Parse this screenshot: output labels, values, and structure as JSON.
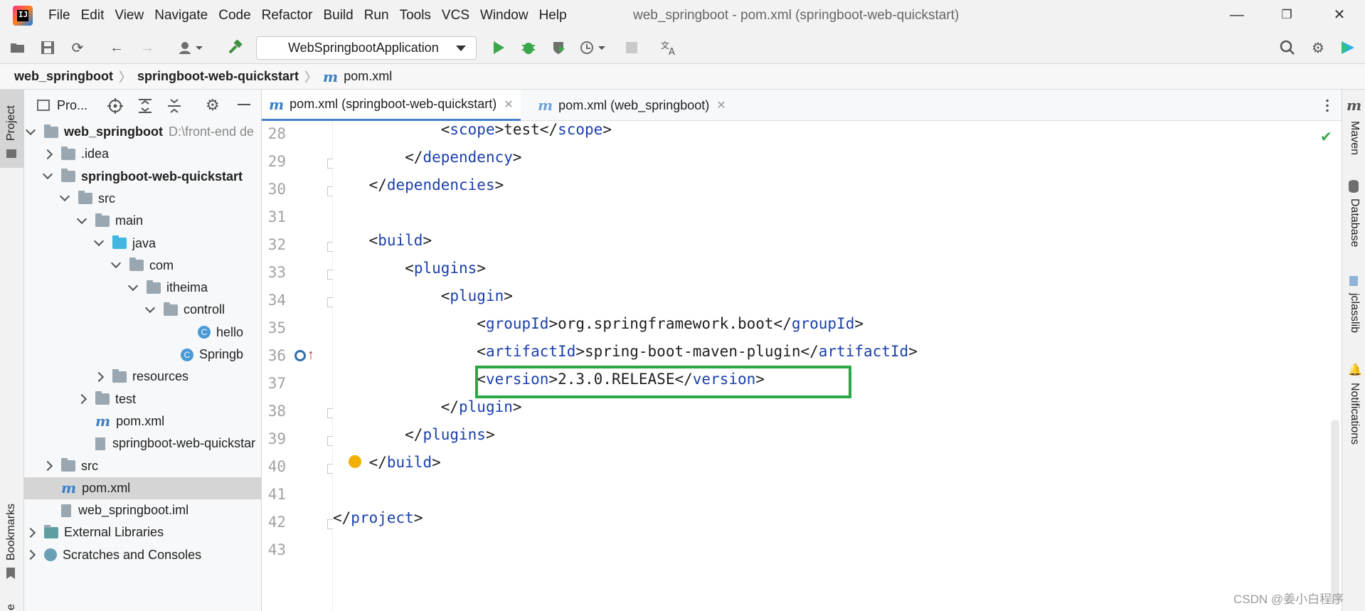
{
  "app": {
    "window_title": "web_springboot - pom.xml (springboot-web-quickstart)",
    "logo_text": "IJ"
  },
  "menu": [
    "File",
    "Edit",
    "View",
    "Navigate",
    "Code",
    "Refactor",
    "Build",
    "Run",
    "Tools",
    "VCS",
    "Window",
    "Help"
  ],
  "toolbar": {
    "run_configuration": "WebSpringbootApplication"
  },
  "breadcrumb": [
    "web_springboot",
    "springboot-web-quickstart",
    "pom.xml"
  ],
  "left_stripe": {
    "project": "Project",
    "bookmarks": "Bookmarks",
    "structure_fragment": "e"
  },
  "project_panel": {
    "title": "Pro...",
    "tree": [
      {
        "label": "web_springboot",
        "extra": "D:\\front-end de",
        "indent": 0,
        "arrow": "down",
        "icon": "module-folder",
        "bold": true
      },
      {
        "label": ".idea",
        "indent": 1,
        "arrow": "right",
        "icon": "folder"
      },
      {
        "label": "springboot-web-quickstart",
        "indent": 1,
        "arrow": "down",
        "icon": "module-folder",
        "bold": true
      },
      {
        "label": "src",
        "indent": 2,
        "arrow": "down",
        "icon": "folder"
      },
      {
        "label": "main",
        "indent": 3,
        "arrow": "down",
        "icon": "folder"
      },
      {
        "label": "java",
        "indent": 4,
        "arrow": "down",
        "icon": "folder-blue"
      },
      {
        "label": "com",
        "indent": 5,
        "arrow": "down",
        "icon": "folder"
      },
      {
        "label": "itheima",
        "indent": 6,
        "arrow": "down",
        "icon": "folder"
      },
      {
        "label": "controll",
        "indent": 7,
        "arrow": "down",
        "icon": "folder"
      },
      {
        "label": "hello",
        "indent": 9,
        "arrow": "none",
        "icon": "class"
      },
      {
        "label": "Springb",
        "indent": 8,
        "arrow": "none",
        "icon": "spring-class"
      },
      {
        "label": "resources",
        "indent": 4,
        "arrow": "right",
        "icon": "folder-res"
      },
      {
        "label": "test",
        "indent": 3,
        "arrow": "right",
        "icon": "folder"
      },
      {
        "label": "pom.xml",
        "indent": 3,
        "arrow": "none",
        "icon": "maven"
      },
      {
        "label": "springboot-web-quickstar",
        "indent": 3,
        "arrow": "none",
        "icon": "file"
      },
      {
        "label": "src",
        "indent": 1,
        "arrow": "right",
        "icon": "folder"
      },
      {
        "label": "pom.xml",
        "indent": 1,
        "arrow": "none",
        "icon": "maven",
        "selected": true
      },
      {
        "label": "web_springboot.iml",
        "indent": 1,
        "arrow": "none",
        "icon": "file"
      },
      {
        "label": "External Libraries",
        "indent": 0,
        "arrow": "right",
        "icon": "libraries"
      },
      {
        "label": "Scratches and Consoles",
        "indent": 0,
        "arrow": "right",
        "icon": "scratches"
      }
    ]
  },
  "tabs": [
    {
      "label": "pom.xml (springboot-web-quickstart)",
      "active": true
    },
    {
      "label": "pom.xml (web_springboot)",
      "active": false
    }
  ],
  "editor": {
    "lines": [
      {
        "num": "28",
        "indent": "            ",
        "parts": [
          [
            "p",
            "<"
          ],
          [
            "t",
            "scope"
          ],
          [
            "p",
            ">test</"
          ],
          [
            "t",
            "scope"
          ],
          [
            "p",
            ">"
          ]
        ]
      },
      {
        "num": "29",
        "indent": "        ",
        "parts": [
          [
            "p",
            "</"
          ],
          [
            "t",
            "dependency"
          ],
          [
            "p",
            ">"
          ]
        ]
      },
      {
        "num": "30",
        "indent": "    ",
        "parts": [
          [
            "p",
            "</"
          ],
          [
            "t",
            "dependencies"
          ],
          [
            "p",
            ">"
          ]
        ]
      },
      {
        "num": "31",
        "indent": "",
        "parts": []
      },
      {
        "num": "32",
        "indent": "    ",
        "parts": [
          [
            "p",
            "<"
          ],
          [
            "t",
            "build"
          ],
          [
            "p",
            ">"
          ]
        ]
      },
      {
        "num": "33",
        "indent": "        ",
        "parts": [
          [
            "p",
            "<"
          ],
          [
            "t",
            "plugins"
          ],
          [
            "p",
            ">"
          ]
        ]
      },
      {
        "num": "34",
        "indent": "            ",
        "parts": [
          [
            "p",
            "<"
          ],
          [
            "t",
            "plugin"
          ],
          [
            "p",
            ">"
          ]
        ]
      },
      {
        "num": "35",
        "indent": "                ",
        "parts": [
          [
            "p",
            "<"
          ],
          [
            "t",
            "groupId"
          ],
          [
            "p",
            ">org.springframework.boot</"
          ],
          [
            "t",
            "groupId"
          ],
          [
            "p",
            ">"
          ]
        ]
      },
      {
        "num": "36",
        "indent": "                ",
        "parts": [
          [
            "p",
            "<"
          ],
          [
            "t",
            "artifactId"
          ],
          [
            "p",
            ">spring-boot-maven-plugin</"
          ],
          [
            "t",
            "artifactId"
          ],
          [
            "p",
            ">"
          ]
        ]
      },
      {
        "num": "37",
        "indent": "                ",
        "parts": [
          [
            "p",
            "<"
          ],
          [
            "t",
            "version"
          ],
          [
            "p",
            ">2.3.0.RELEASE</"
          ],
          [
            "t",
            "version"
          ],
          [
            "p",
            ">"
          ]
        ]
      },
      {
        "num": "38",
        "indent": "            ",
        "parts": [
          [
            "p",
            "</"
          ],
          [
            "t",
            "plugin"
          ],
          [
            "p",
            ">"
          ]
        ]
      },
      {
        "num": "39",
        "indent": "        ",
        "parts": [
          [
            "p",
            "</"
          ],
          [
            "t",
            "plugins"
          ],
          [
            "p",
            ">"
          ]
        ]
      },
      {
        "num": "40",
        "indent": "    ",
        "parts": [
          [
            "p",
            "</"
          ],
          [
            "t",
            "build"
          ],
          [
            "p",
            ">"
          ]
        ]
      },
      {
        "num": "41",
        "indent": "",
        "parts": []
      },
      {
        "num": "42",
        "indent": "",
        "parts": [
          [
            "p",
            "</"
          ],
          [
            "t",
            "project"
          ],
          [
            "p",
            ">"
          ]
        ]
      },
      {
        "num": "43",
        "indent": "",
        "parts": []
      }
    ]
  },
  "right_stripe": [
    "Maven",
    "Database",
    "jclasslib",
    "Notifications"
  ],
  "watermark": "CSDN @姜小白程序",
  "colors": {
    "highlight_box": "#2aa845",
    "tag": "#1a3faa",
    "active_tab": "#4083c9",
    "check": "#3aa84a"
  }
}
